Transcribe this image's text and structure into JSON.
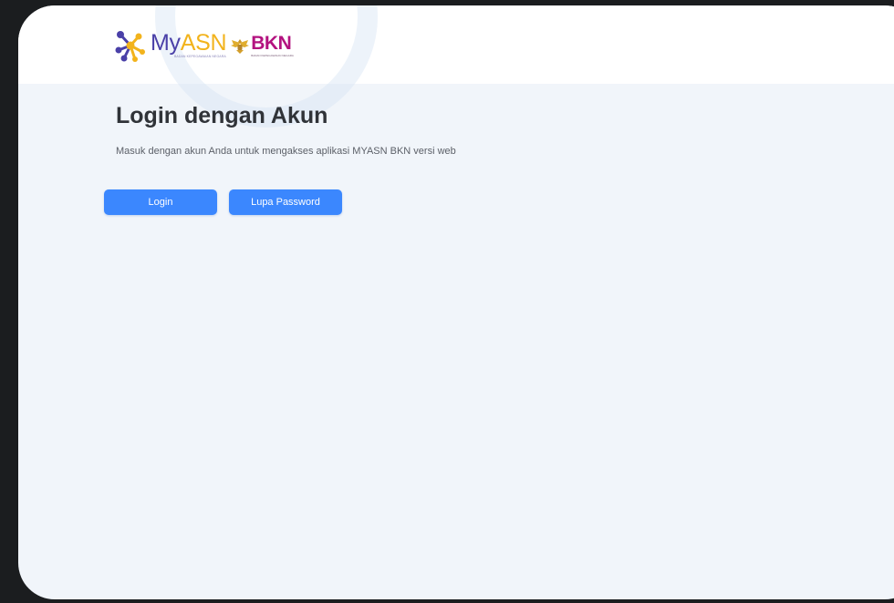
{
  "header": {
    "logo_myasn_prefix": "My",
    "logo_myasn_suffix": "ASN",
    "logo_myasn_caption": "BADAN KEPEGAWAIAN NEGARA",
    "logo_bkn": "BKN",
    "logo_bkn_caption": "BADAN KEPEGAWAIAN NEGARA"
  },
  "main": {
    "title": "Login dengan Akun",
    "subtitle": "Masuk dengan akun Anda untuk mengakses aplikasi MYASN BKN versi web",
    "login_button": "Login",
    "forgot_button": "Lupa Password"
  },
  "colors": {
    "accent": "#3b87fe",
    "page_bg": "#f1f5fa",
    "myasn_purple": "#4a40a8",
    "myasn_yellow": "#f2b31c",
    "bkn_magenta": "#b3127f"
  },
  "icons": [
    "myasn-logo-icon",
    "garuda-emblem-icon"
  ]
}
